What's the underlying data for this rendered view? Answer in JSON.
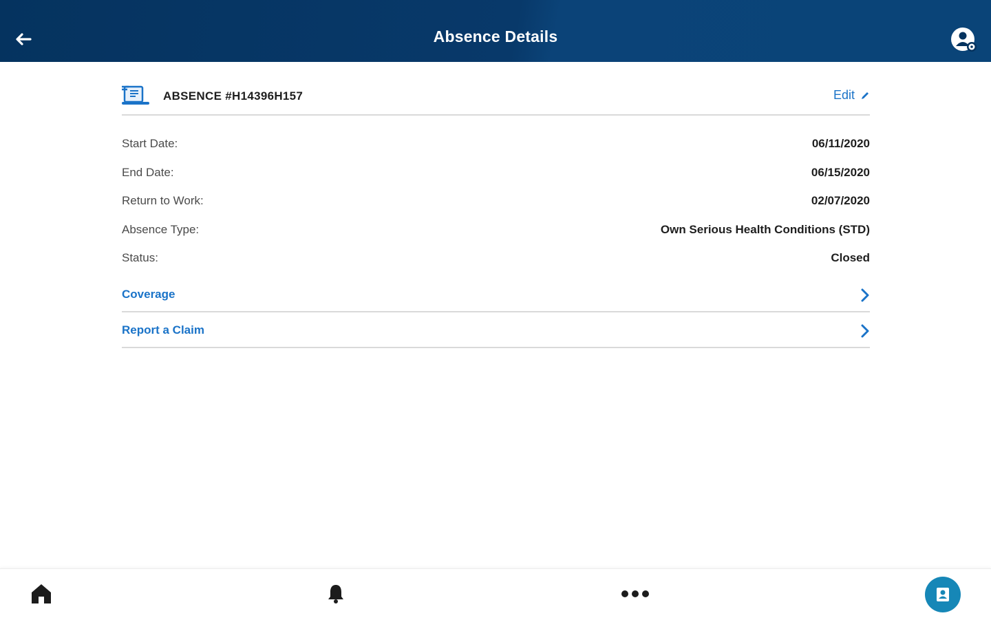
{
  "header": {
    "title": "Absence Details",
    "back_icon": "arrow-left-icon",
    "profile_icon": "user-settings-icon"
  },
  "absence": {
    "id_label": "ABSENCE #H14396H157",
    "edit_label": "Edit"
  },
  "details": [
    {
      "label": "Start Date:",
      "value": "06/11/2020"
    },
    {
      "label": "End Date:",
      "value": "06/15/2020"
    },
    {
      "label": "Return to Work:",
      "value": "02/07/2020"
    },
    {
      "label": "Absence Type:",
      "value": "Own Serious Health Conditions (STD)"
    },
    {
      "label": "Status:",
      "value": "Closed"
    }
  ],
  "links": [
    {
      "label": "Coverage"
    },
    {
      "label": "Report a Claim"
    }
  ],
  "bottom_nav": [
    "home-icon",
    "bell-icon",
    "more-icon",
    "contact-card-icon"
  ],
  "colors": {
    "header_bg": "#05335f",
    "link": "#1a73c8",
    "fab": "#1687b7"
  }
}
